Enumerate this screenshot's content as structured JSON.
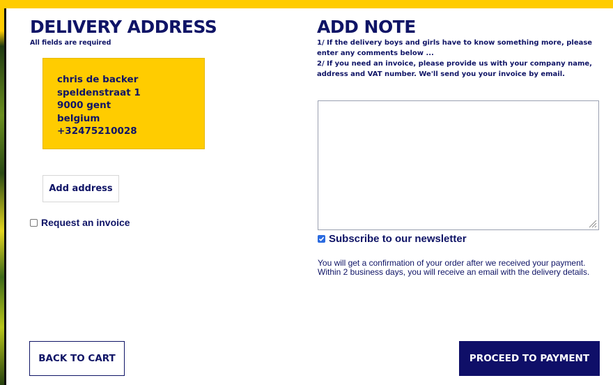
{
  "delivery": {
    "title": "DELIVERY ADDRESS",
    "subtitle": "All fields are required",
    "address": {
      "name": "chris de backer",
      "street": "speldenstraat 1",
      "city": "9000 gent",
      "country": "belgium",
      "phone": "+32475210028"
    },
    "add_address_label": "Add address",
    "invoice_label": "Request an invoice",
    "invoice_checked": false
  },
  "note": {
    "title": "ADD NOTE",
    "lines": [
      "1/ If the delivery boys and girls have to know something more, please",
      "enter any comments below ...",
      "2/ If you need an invoice, please provide us with your company name,",
      "address and VAT number. We'll send you your invoice by email."
    ],
    "value": "",
    "newsletter_label": "Subscribe to our newsletter",
    "newsletter_checked": true,
    "confirmation": "You will get a confirmation of your order after we received your payment. Within 2 business days, you will receive an email with the delivery details."
  },
  "actions": {
    "back_label": "BACK TO CART",
    "proceed_label": "PROCEED TO PAYMENT"
  },
  "colors": {
    "brand_yellow": "#ffcc00",
    "navy": "#0f1466",
    "checkbox_blue": "#2b6be0"
  }
}
